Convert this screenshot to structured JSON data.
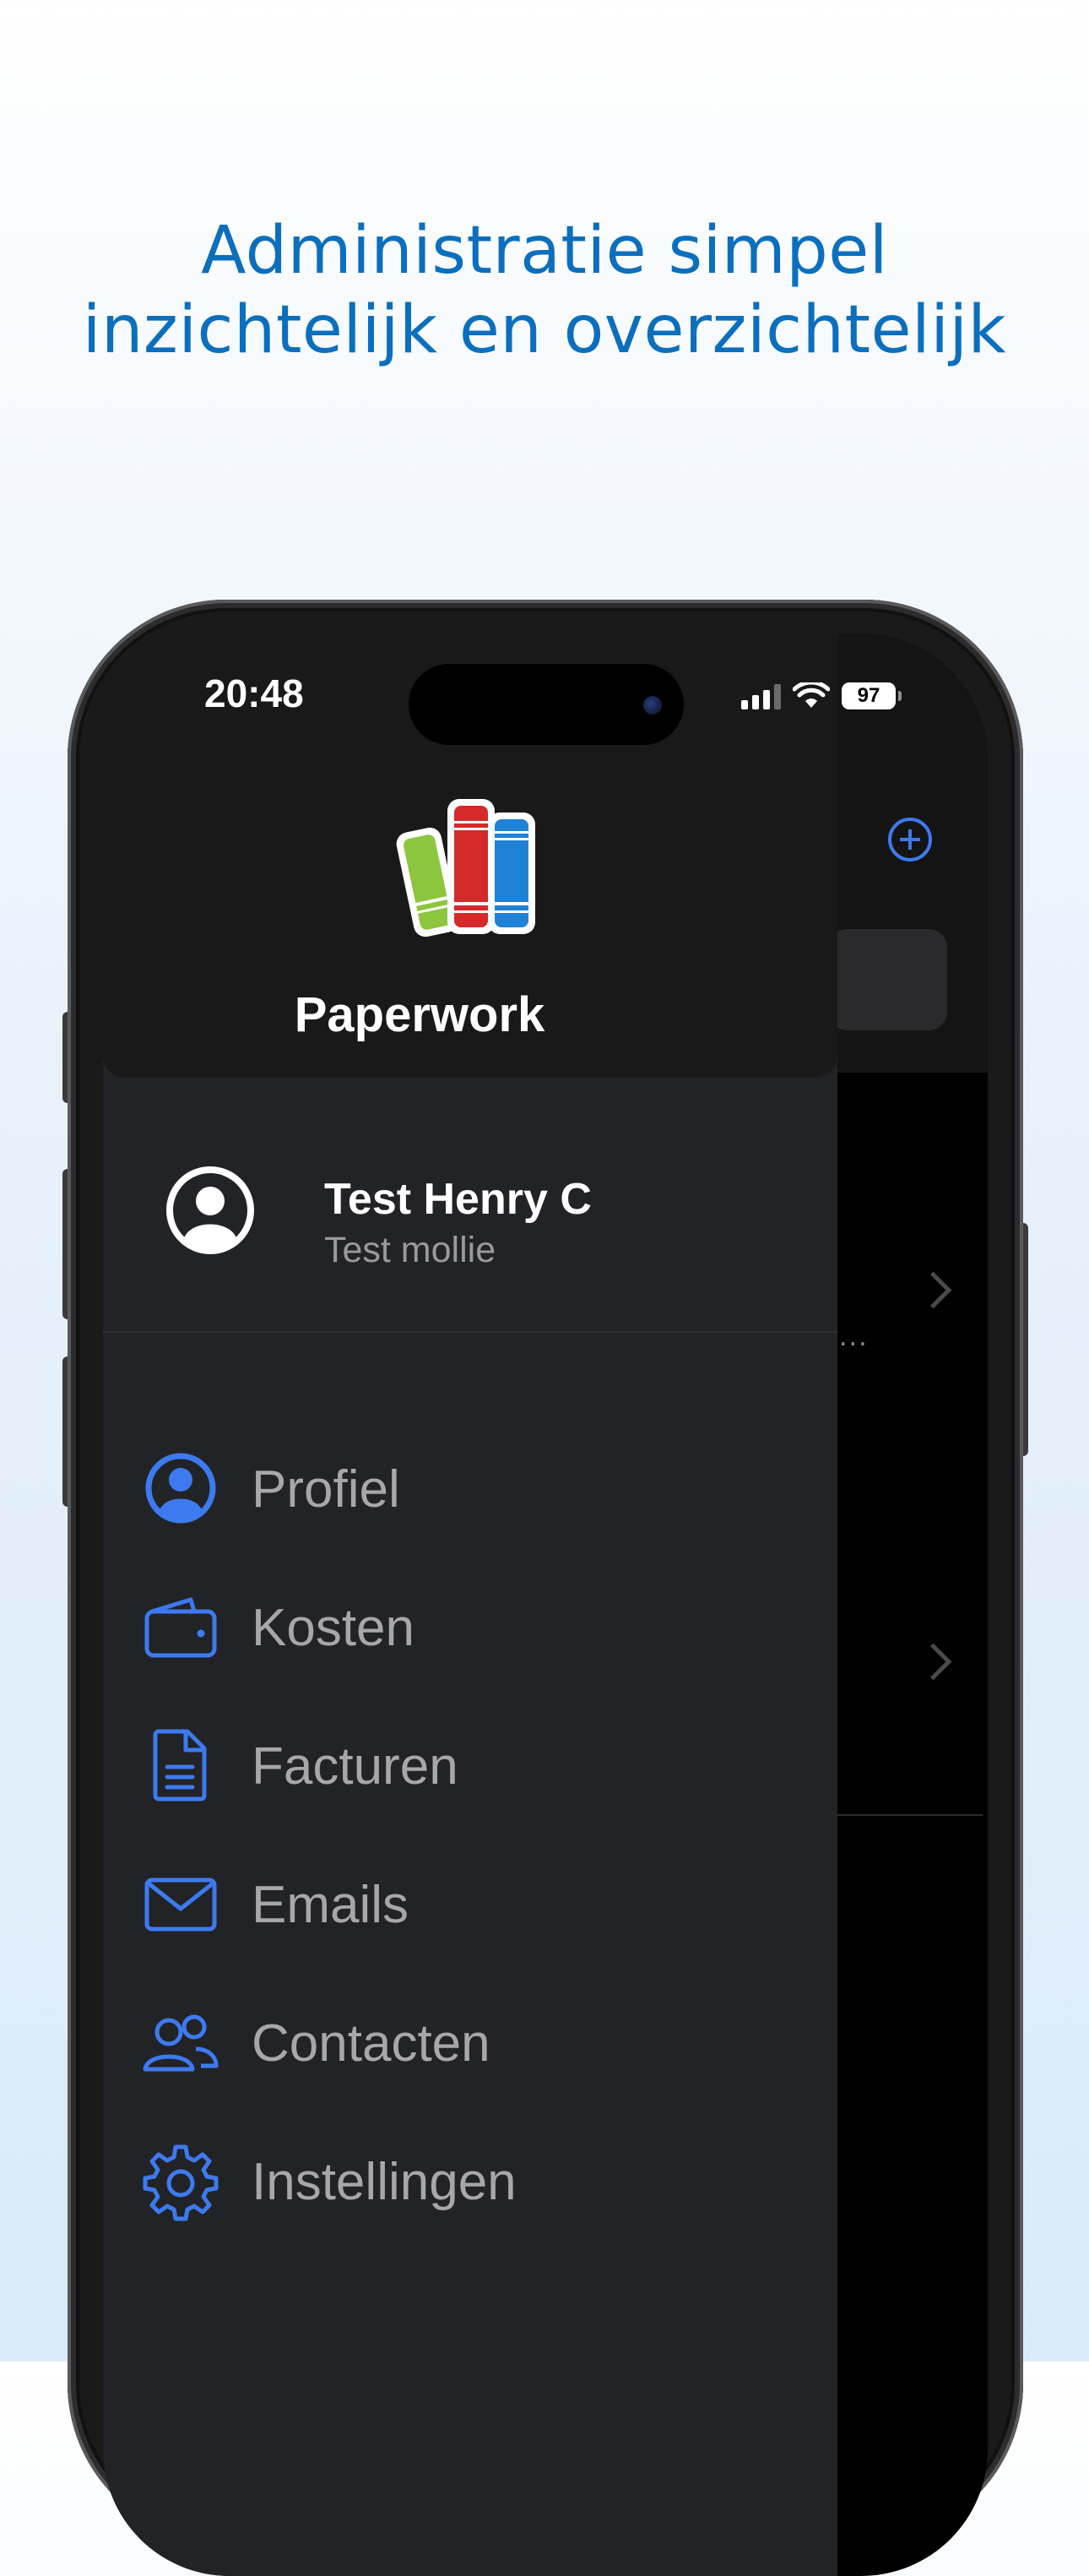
{
  "headline": {
    "line1": "Administratie simpel",
    "line2": "inzichtelijk en overzichtelijk"
  },
  "status_bar": {
    "time": "20:48",
    "battery": "97"
  },
  "app": {
    "name": "Paperwork",
    "logo_icon": "books-logo-icon"
  },
  "user": {
    "name": "Test Henry C",
    "subtitle": "Test mollie"
  },
  "menu": {
    "items": [
      {
        "label": "Profiel",
        "icon": "person-circle-icon"
      },
      {
        "label": "Kosten",
        "icon": "wallet-icon"
      },
      {
        "label": "Facturen",
        "icon": "document-icon"
      },
      {
        "label": "Emails",
        "icon": "envelope-icon"
      },
      {
        "label": "Contacten",
        "icon": "people-icon"
      },
      {
        "label": "Instellingen",
        "icon": "gear-icon"
      }
    ]
  },
  "background_screen": {
    "truncation": "..."
  },
  "colors": {
    "headline": "#0b6fbe",
    "accent": "#3d7af0",
    "drawer": "#222326",
    "drawer_header": "#19191a"
  }
}
